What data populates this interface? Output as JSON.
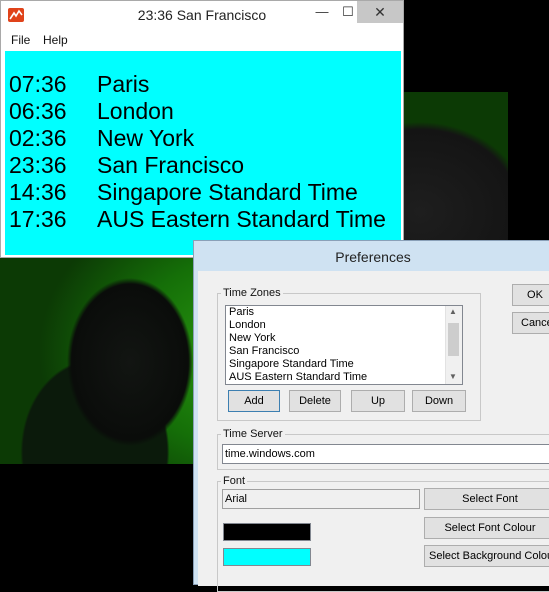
{
  "clock_window": {
    "title": "23:36 San Francisco",
    "controls": {
      "minimize": "—",
      "maximize": "☐",
      "close": "✕"
    },
    "menu": [
      "File",
      "Help"
    ],
    "background_color": "#00ffff",
    "rows": [
      {
        "time": "07:36",
        "zone": "Paris"
      },
      {
        "time": "06:36",
        "zone": "London"
      },
      {
        "time": "02:36",
        "zone": "New York"
      },
      {
        "time": "23:36",
        "zone": "San Francisco"
      },
      {
        "time": "14:36",
        "zone": "Singapore Standard Time"
      },
      {
        "time": "17:36",
        "zone": "AUS Eastern Standard Time"
      }
    ]
  },
  "preferences": {
    "title": "Preferences",
    "ok_label": "OK",
    "cancel_label": "Cance",
    "time_zones": {
      "legend": "Time Zones",
      "items": [
        "Paris",
        "London",
        "New York",
        "San Francisco",
        "Singapore Standard Time",
        "AUS Eastern Standard Time"
      ],
      "add_label": "Add",
      "delete_label": "Delete",
      "up_label": "Up",
      "down_label": "Down"
    },
    "time_server": {
      "legend": "Time Server",
      "value": "time.windows.com"
    },
    "font": {
      "legend": "Font",
      "value": "Arial",
      "select_font_label": "Select Font",
      "select_font_colour_label": "Select Font Colour",
      "select_background_colour_label": "Select Background Colour",
      "font_colour": "#000000",
      "background_colour": "#00ffff"
    }
  }
}
